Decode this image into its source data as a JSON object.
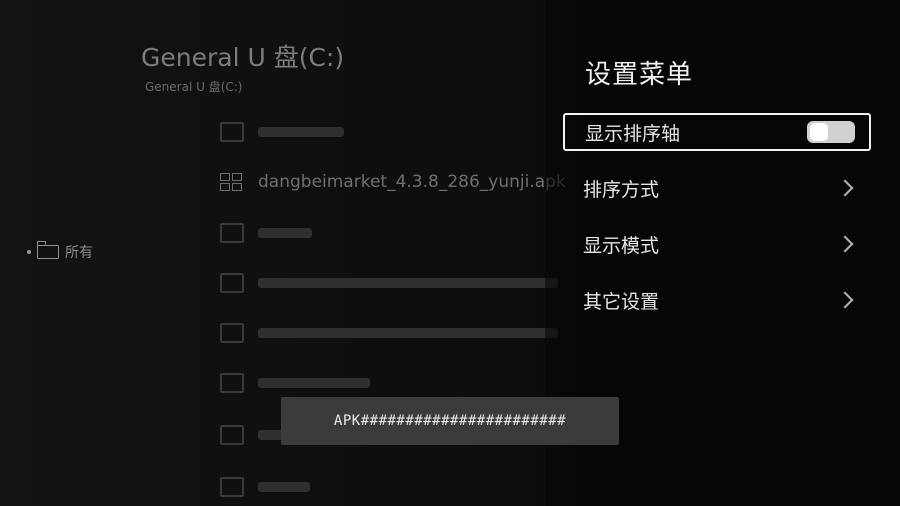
{
  "browser": {
    "drive_title": "General U 盘(C:)",
    "drive_subtitle": "General U 盘(C:)",
    "category_label": "所有",
    "visible_file": "dangbeimarket_4.3.8_286_yunji.apk"
  },
  "settings_menu": {
    "title": "设置菜单",
    "items": [
      {
        "label": "显示排序轴",
        "control": "toggle",
        "toggle_on": false
      },
      {
        "label": "排序方式",
        "control": "chevron"
      },
      {
        "label": "显示模式",
        "control": "chevron"
      },
      {
        "label": "其它设置",
        "control": "chevron"
      }
    ]
  },
  "toast": {
    "message": "APK#######################"
  },
  "icons": {
    "category": "folder-icon",
    "file_type": "grid-icon",
    "submenu": "chevron-right-icon"
  }
}
